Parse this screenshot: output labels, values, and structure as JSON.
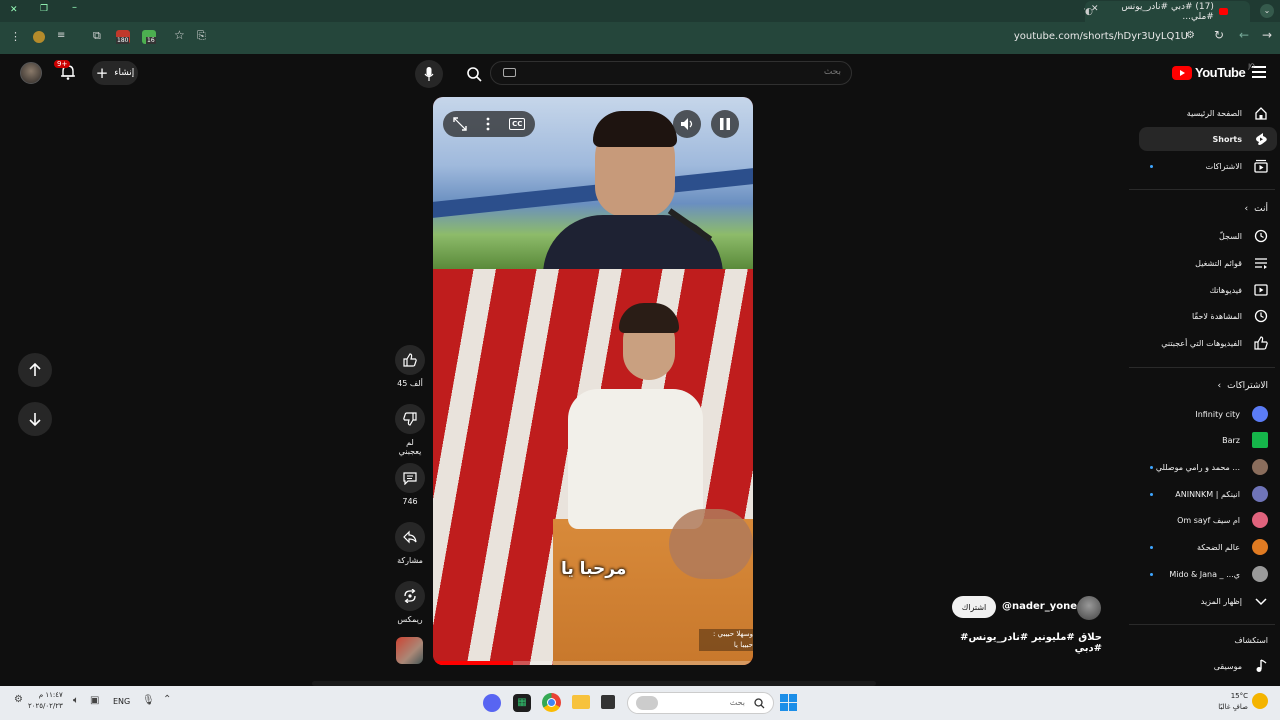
{
  "browser": {
    "tab_title": "(17) #دبي #نادر_يونس #ملي...",
    "url": "youtube.com/shorts/hDyr3UyLQ1U",
    "ext_badge_1": "180",
    "ext_badge_2": "16"
  },
  "header": {
    "logo_text": "YouTube",
    "logo_region": "JO",
    "search_placeholder": "بحث",
    "create_label": "إنشاء",
    "notif_badge": "9+"
  },
  "sidebar": {
    "main": [
      {
        "label": "الصفحة الرئيسية",
        "icon": "home-icon"
      },
      {
        "label": "Shorts",
        "icon": "shorts-icon"
      },
      {
        "label": "الاشتراكات",
        "icon": "subscriptions-icon"
      }
    ],
    "you_header": "أنت",
    "you": [
      {
        "label": "السجلّ",
        "icon": "history-icon"
      },
      {
        "label": "قوائم التشغيل",
        "icon": "playlist-icon"
      },
      {
        "label": "فيديوهاتك",
        "icon": "your-videos-icon"
      },
      {
        "label": "المشاهدة لاحقًا",
        "icon": "watch-later-icon"
      },
      {
        "label": "الفيديوهات التي أعجبتني",
        "icon": "liked-icon"
      }
    ],
    "subs_header": "الاشتراكات",
    "subs": [
      {
        "label": "Infinity city",
        "color": "#5b7cf5"
      },
      {
        "label": "Barz",
        "color": "#15b64a"
      },
      {
        "label": "محمد و رامي موصللي ...",
        "color": "#8a6d5c"
      },
      {
        "label": "ANINNKM | انينكم",
        "color": "#6f74b8"
      },
      {
        "label": "Om sayf ام سيف",
        "color": "#e0637d"
      },
      {
        "label": "عالم الضحكة",
        "color": "#e07b22"
      },
      {
        "label": "Mido & Jana _ ...ي",
        "color": "#9a9a9a"
      }
    ],
    "show_more": "إظهار المزيد",
    "explore_header": "استكشاف",
    "explore": [
      {
        "label": "موسيقى",
        "icon": "music-icon"
      }
    ]
  },
  "short": {
    "subtitle": "مرحبا يا",
    "corner_caption_1": ": وسهلا حبيبي",
    "corner_caption_2": "حبيبا يا",
    "channel": "@nader_yones",
    "subscribe": "اشتراك",
    "title": "#حلاق #مليونير #نادر_يونس #دبي",
    "likes": "45 ألف",
    "dislike_label": "لم يعجبني",
    "comments": "746",
    "share_label": "مشاركة",
    "remix_label": "ريمكس",
    "progress": 0.25
  },
  "taskbar": {
    "weather_temp": "15°C",
    "weather_text": "صافٍ غالبًا",
    "search_placeholder": "بحث",
    "lang": "ENG",
    "time": "١١:٤٧ م",
    "date": "٢٠٢٥/٠٢/٢٣"
  },
  "colors": {
    "yt_red": "#ff0000",
    "chrome_green": "#25463b",
    "accent_blue": "#3ea6ff"
  }
}
